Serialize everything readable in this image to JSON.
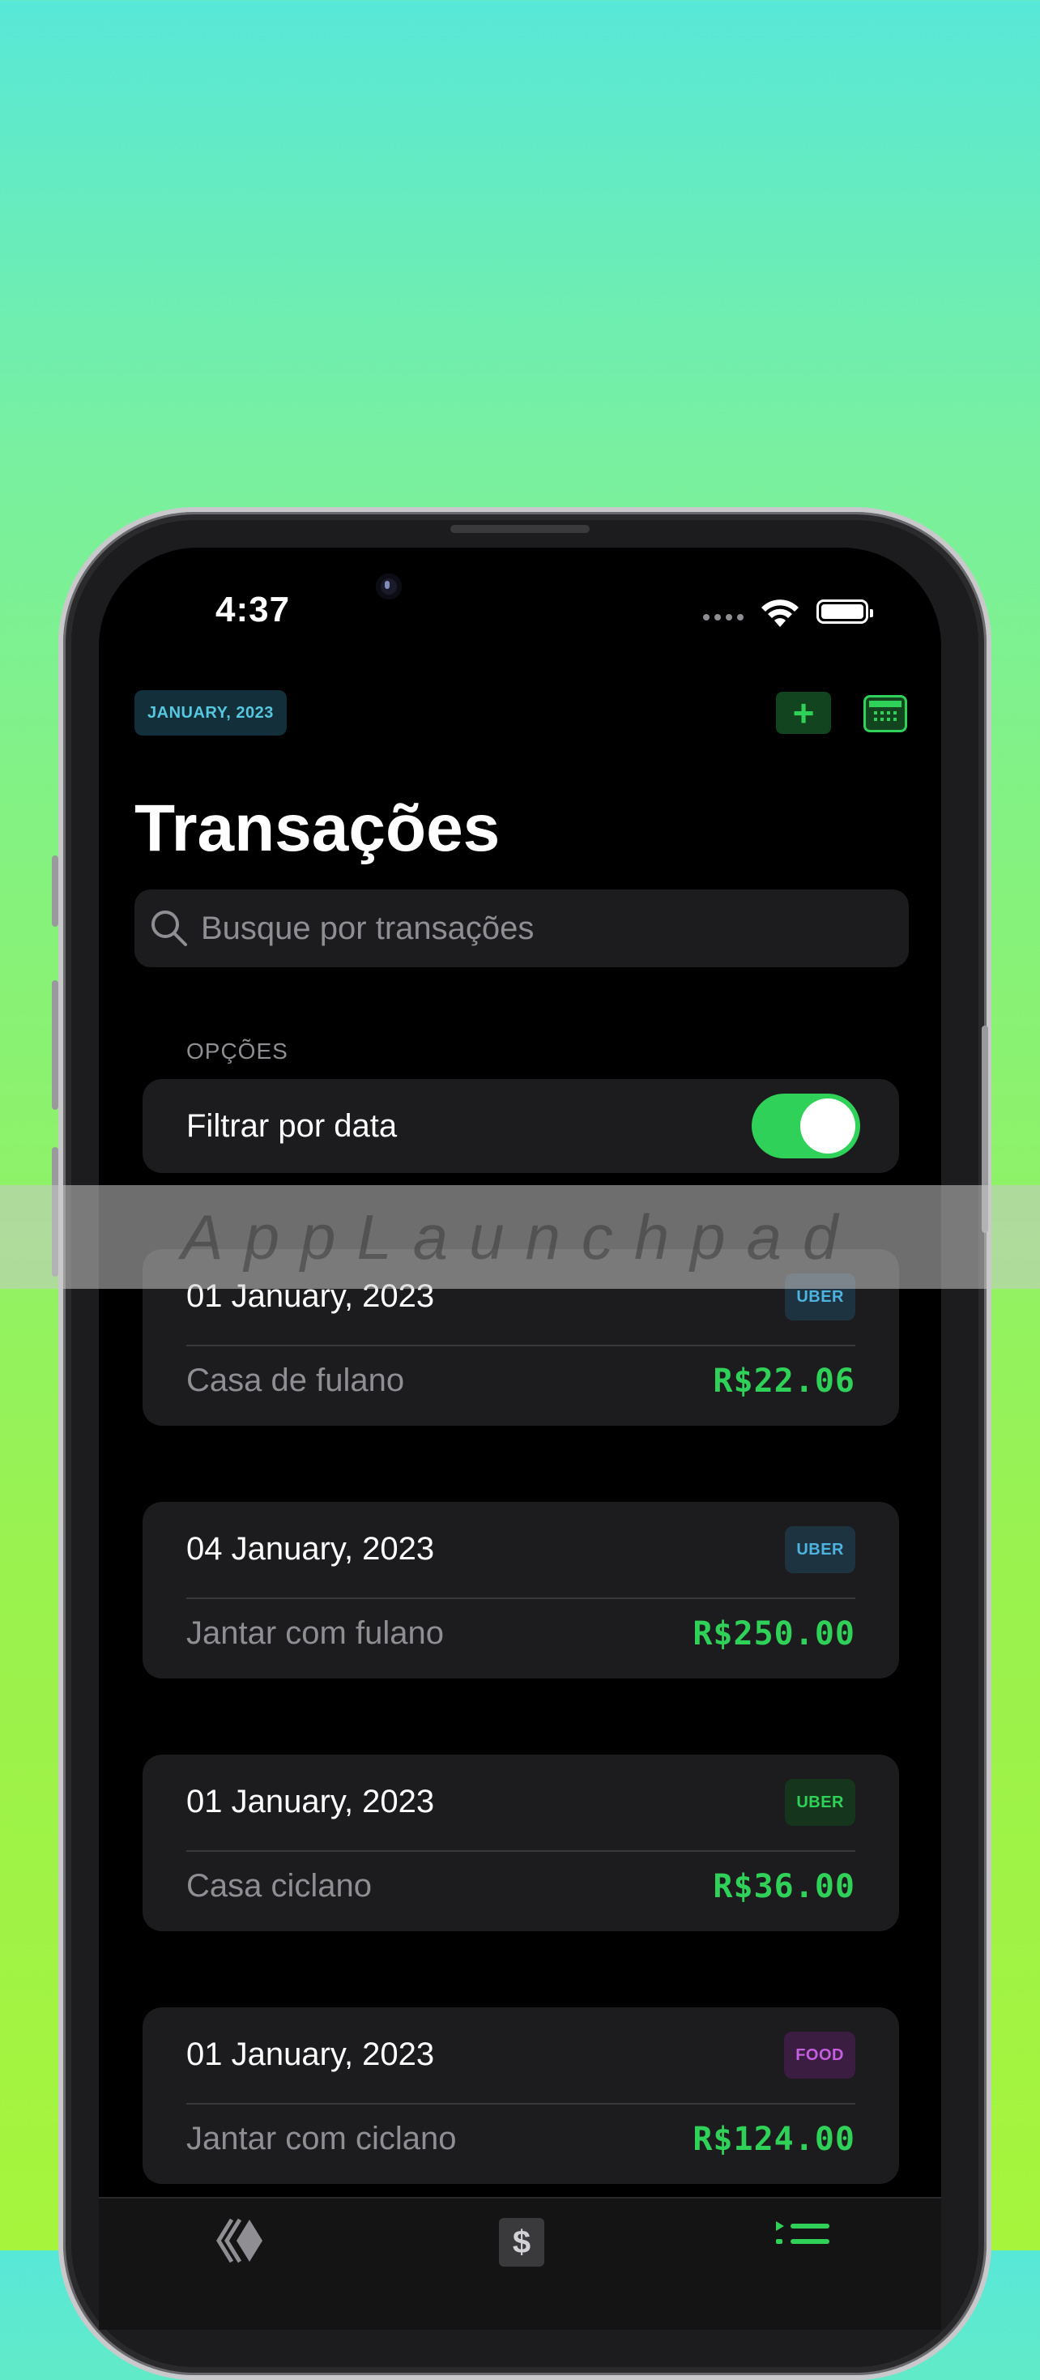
{
  "status_bar": {
    "time": "4:37"
  },
  "header": {
    "month_badge": "JANUARY, 2023",
    "add_button_icon": "plus-icon",
    "calendar_button_icon": "calendar-icon"
  },
  "page_title": "Transações",
  "search": {
    "placeholder": "Busque por transações",
    "icon": "search-icon"
  },
  "options": {
    "section_title": "OPÇÕES",
    "filter_by_date_label": "Filtrar por data",
    "filter_by_date_enabled": true
  },
  "transactions": [
    {
      "date": "01 January, 2023",
      "tag": "UBER",
      "tag_bg": "#1d3440",
      "tag_color": "#4db3e0",
      "description": "Casa de fulano",
      "amount": "R$22.06"
    },
    {
      "date": "04 January, 2023",
      "tag": "UBER",
      "tag_bg": "#1d3440",
      "tag_color": "#4db3e0",
      "description": "Jantar com fulano",
      "amount": "R$250.00"
    },
    {
      "date": "01 January, 2023",
      "tag": "UBER",
      "tag_bg": "#16351d",
      "tag_color": "#30d158",
      "description": "Casa ciclano",
      "amount": "R$36.00"
    },
    {
      "date": "01 January, 2023",
      "tag": "FOOD",
      "tag_bg": "#3a1d40",
      "tag_color": "#c65ee0",
      "description": "Jantar com ciclano",
      "amount": "R$124.00"
    }
  ],
  "tabbar": {
    "tabs": [
      {
        "icon": "layers-icon"
      },
      {
        "icon": "dollar-icon"
      },
      {
        "icon": "list-icon"
      }
    ]
  },
  "watermark": "AppLaunchpad",
  "colors": {
    "accent": "#30d158",
    "background": "#000000",
    "card": "#1c1c1e"
  }
}
